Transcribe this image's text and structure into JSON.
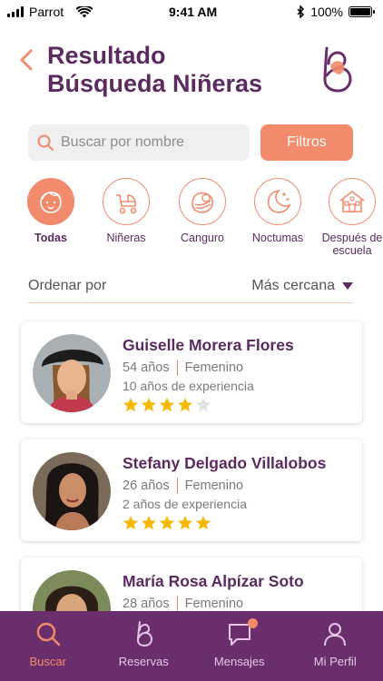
{
  "status_bar": {
    "carrier": "Parrot",
    "time": "9:41 AM",
    "battery": "100%"
  },
  "header": {
    "title_line1": "Resultado",
    "title_line2": "Búsqueda Niñeras"
  },
  "search": {
    "placeholder": "Buscar por nombre",
    "filter_label": "Filtros"
  },
  "categories": [
    {
      "label": "Todas",
      "icon": "baby-face-icon",
      "active": true
    },
    {
      "label": "Niñeras",
      "icon": "stroller-icon"
    },
    {
      "label": "Canguro",
      "icon": "swaddled-baby-icon"
    },
    {
      "label": "Noctumas",
      "icon": "moon-stars-icon"
    },
    {
      "label_line1": "Después de",
      "label_line2": "escuela",
      "icon": "school-icon"
    }
  ],
  "sort": {
    "label": "Ordenar por",
    "value": "Más cercana"
  },
  "results": [
    {
      "name": "Guiselle Morera Flores",
      "age": "54 años",
      "gender": "Femenino",
      "experience": "10 años de experiencia",
      "rating": 4
    },
    {
      "name": "Stefany Delgado Villalobos",
      "age": "26 años",
      "gender": "Femenino",
      "experience": "2 años de experiencia",
      "rating": 5
    },
    {
      "name": "María Rosa Alpízar Soto",
      "age": "28 años",
      "gender": "Femenino"
    }
  ],
  "tabs": [
    {
      "label": "Buscar",
      "icon": "search-icon",
      "active": true
    },
    {
      "label": "Reservas",
      "icon": "reservations-icon"
    },
    {
      "label": "Mensajes",
      "icon": "chat-icon",
      "badge": true
    },
    {
      "label": "Mi Perfil",
      "icon": "user-icon"
    }
  ],
  "colors": {
    "primary": "#5b2a5f",
    "accent": "#f28b6b",
    "tab_bar": "#6b2e6c",
    "star": "#f5b800"
  }
}
